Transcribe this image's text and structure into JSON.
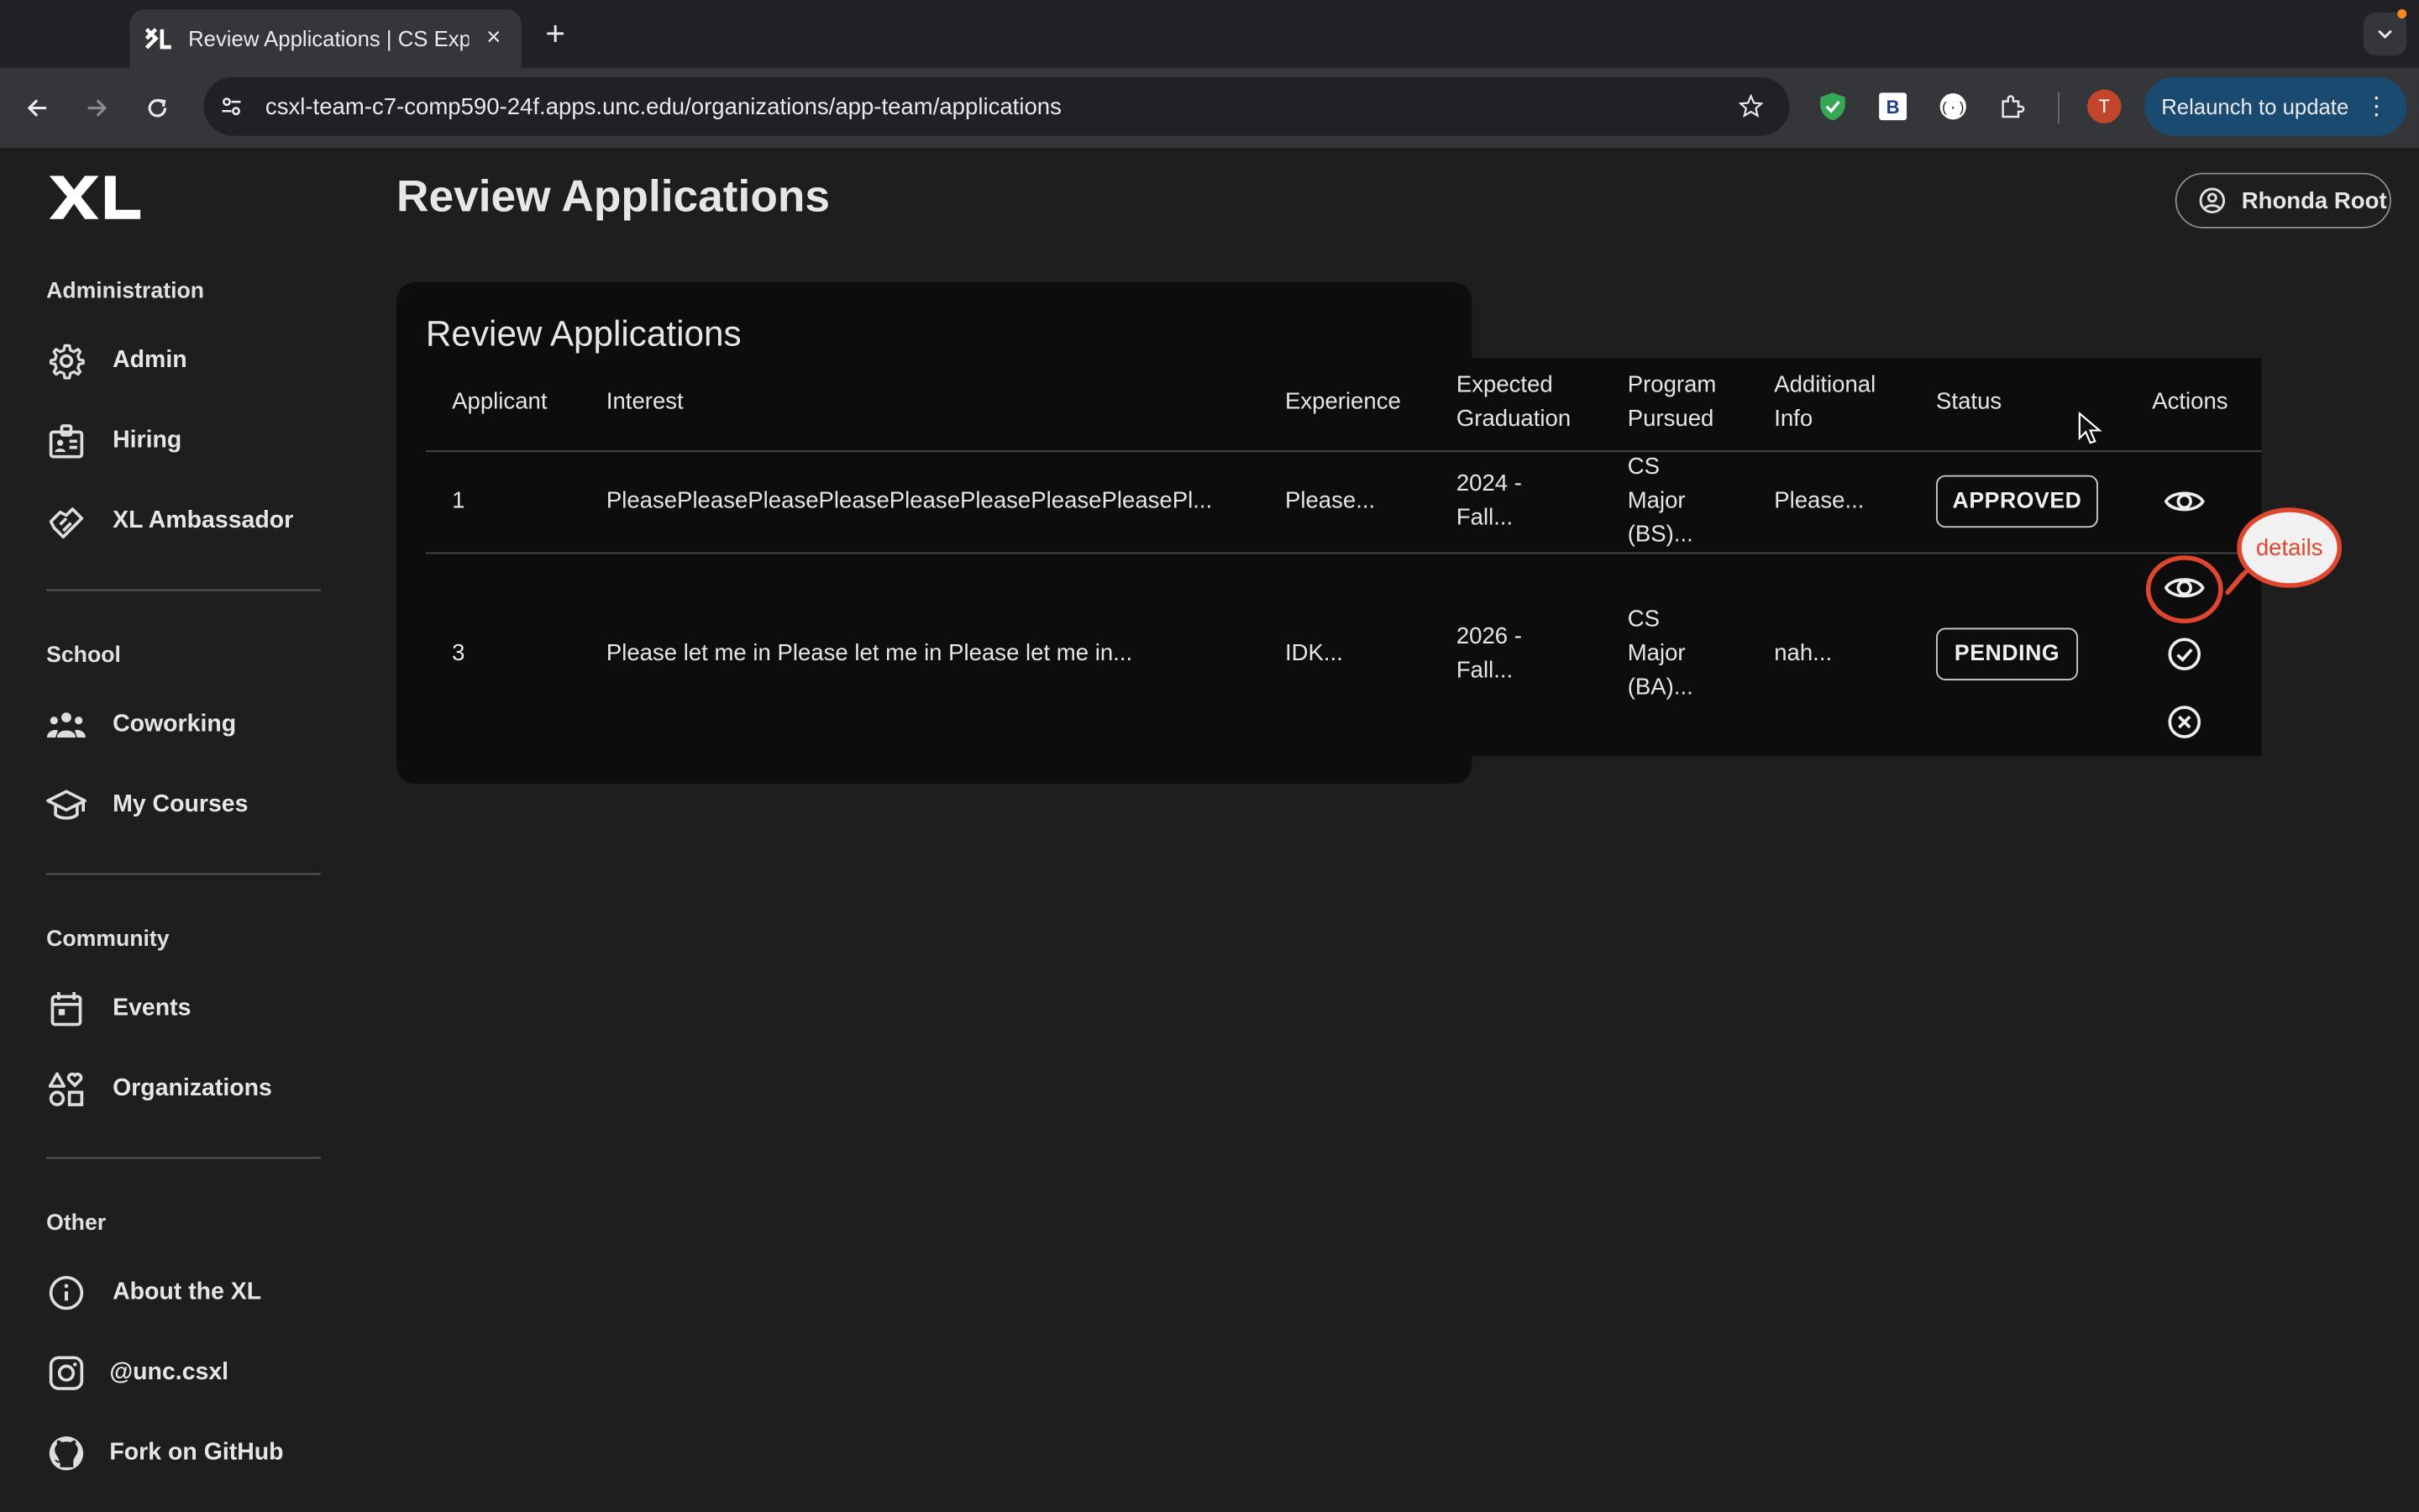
{
  "browser": {
    "tab_title": "Review Applications | CS Exp",
    "tab_close": "×",
    "new_tab": "+",
    "url": "csxl-team-c7-comp590-24f.apps.unc.edu/organizations/app-team/applications",
    "profile_initial": "T",
    "relaunch_label": "Relaunch to update",
    "relaunch_more": "⋮"
  },
  "sidebar": {
    "sections": [
      {
        "title": "Administration",
        "items": [
          {
            "label": "Admin",
            "icon": "gear-icon"
          },
          {
            "label": "Hiring",
            "icon": "badge-icon"
          },
          {
            "label": "XL Ambassador",
            "icon": "handshake-icon"
          }
        ]
      },
      {
        "title": "School",
        "items": [
          {
            "label": "Coworking",
            "icon": "group-icon"
          },
          {
            "label": "My Courses",
            "icon": "school-icon"
          }
        ]
      },
      {
        "title": "Community",
        "items": [
          {
            "label": "Events",
            "icon": "calendar-icon"
          },
          {
            "label": "Organizations",
            "icon": "shapes-icon"
          }
        ]
      },
      {
        "title": "Other",
        "items": [
          {
            "label": "About the XL",
            "icon": "info-icon"
          },
          {
            "label": "@unc.csxl",
            "icon": "instagram-icon"
          },
          {
            "label": "Fork on GitHub",
            "icon": "github-icon"
          }
        ]
      }
    ]
  },
  "header": {
    "page_title": "Review Applications",
    "user_name": "Rhonda Root"
  },
  "card": {
    "title": "Review Applications",
    "columns": [
      "Applicant",
      "Interest",
      "Experience",
      "Expected\nGraduation",
      "Program\nPursued",
      "Additional\nInfo",
      "Status",
      "Actions"
    ],
    "rows": [
      {
        "applicant": "1",
        "interest": "PleasePleasePleasePleasePleasePleasePleasePleasePl...",
        "experience": "Please...",
        "graduation": [
          "2024 -",
          "Fall..."
        ],
        "program": [
          "CS",
          "Major",
          "(BS)..."
        ],
        "additional": "Please...",
        "status": "APPROVED",
        "actions": [
          "eye-icon"
        ]
      },
      {
        "applicant": "3",
        "interest": "Please let me in Please let me in Please let me in...",
        "experience": "IDK...",
        "graduation": [
          "2026 -",
          "Fall..."
        ],
        "program": [
          "CS",
          "Major",
          "(BA)..."
        ],
        "additional": "nah...",
        "status": "PENDING",
        "actions": [
          "eye-icon",
          "check-circle-icon",
          "cancel-circle-icon"
        ]
      }
    ]
  },
  "annotation": {
    "callout_text": "details",
    "color": "#e0462d"
  }
}
